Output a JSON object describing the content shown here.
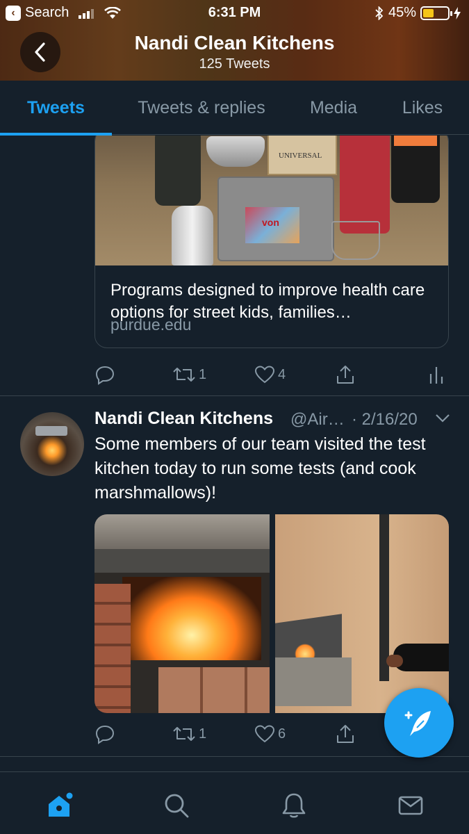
{
  "status_bar": {
    "back_app": "Search",
    "time": "6:31 PM",
    "battery": "45%",
    "battery_level": 0.45
  },
  "header": {
    "title": "Nandi Clean Kitchens",
    "subtitle": "125 Tweets"
  },
  "tabs": [
    {
      "label": "Tweets",
      "active": true
    },
    {
      "label": "Tweets & replies",
      "active": false
    },
    {
      "label": "Media",
      "active": false
    },
    {
      "label": "Likes",
      "active": false
    }
  ],
  "tweet1": {
    "card_text": "Programs designed to improve health care options for street kids, families…",
    "card_domain": "purdue.edu",
    "retweets": "1",
    "likes": "4",
    "image_labels": {
      "box": "UNIVERSAL",
      "sticker": "von"
    }
  },
  "tweet2": {
    "name": "Nandi Clean Kitchens",
    "handle": "@Air…",
    "date": "· 2/16/20",
    "text": "Some members of our team visited the test kitchen today to run some tests (and cook marshmallows)!",
    "retweets": "1",
    "likes": "6"
  },
  "colors": {
    "background": "#15202b",
    "accent": "#1da1f2",
    "muted": "#8899a6",
    "divider": "#38444d"
  },
  "icons": {
    "reply": "reply-icon",
    "retweet": "retweet-icon",
    "like": "heart-icon",
    "share": "share-icon",
    "analytics": "analytics-icon",
    "compose": "compose-tweet-icon",
    "home": "home-icon",
    "search": "search-icon",
    "notifications": "bell-icon",
    "messages": "mail-icon"
  }
}
